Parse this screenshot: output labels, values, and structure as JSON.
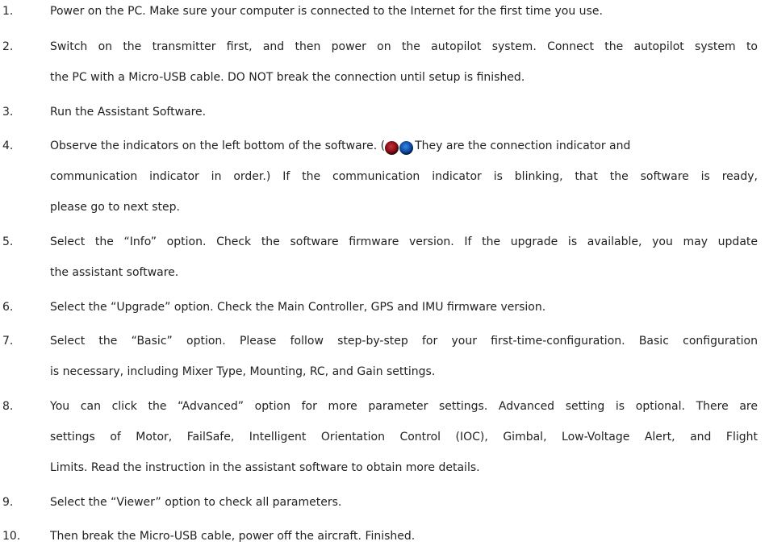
{
  "steps": [
    {
      "number": "1.",
      "lines": [
        "Power on the PC. Make sure your computer is connected to the Internet for the first time you use."
      ]
    },
    {
      "number": "2.",
      "lines": [
        "Switch on the transmitter first, and then power on the autopilot system. Connect the autopilot system to",
        "the PC with a Micro-USB cable. DO NOT break the connection until setup is finished."
      ]
    },
    {
      "number": "3.",
      "lines": [
        "Run the Assistant Software."
      ]
    },
    {
      "number": "4.",
      "line1_before": "Observe the indicators on the left bottom of the software. (",
      "line1_after": "They are the connection indicator and",
      "lines": [
        "communication indicator in order.) If the communication indicator is blinking, that the software is ready,",
        "please go to next step."
      ],
      "indicator_icons": [
        "connection-indicator-icon (red)",
        "communication-indicator-icon (blue)"
      ]
    },
    {
      "number": "5.",
      "lines": [
        "Select the “Info” option. Check the software firmware version. If the upgrade is available, you may update",
        "the assistant software."
      ]
    },
    {
      "number": "6.",
      "lines": [
        "Select the “Upgrade” option. Check the Main Controller, GPS and IMU firmware version."
      ]
    },
    {
      "number": "7.",
      "lines": [
        "Select the “Basic” option. Please follow step-by-step for your first-time-configuration. Basic configuration",
        "is necessary, including Mixer Type, Mounting, RC, and Gain settings."
      ]
    },
    {
      "number": "8.",
      "lines": [
        "You can click the “Advanced” option for more parameter settings. Advanced setting is optional. There are",
        "settings of Motor, FailSafe, Intelligent Orientation Control (IOC), Gimbal, Low-Voltage Alert, and Flight",
        "Limits. Read the instruction in the assistant software to obtain more details."
      ]
    },
    {
      "number": "9.",
      "lines": [
        "Select the “Viewer” option to check all parameters."
      ]
    },
    {
      "number": "10.",
      "lines": [
        "Then break the Micro-USB cable, power off the aircraft. Finished."
      ]
    }
  ],
  "colors": {
    "text": "#222222",
    "indicator_red": "#8a0f18",
    "indicator_blue": "#0f4fa8"
  }
}
